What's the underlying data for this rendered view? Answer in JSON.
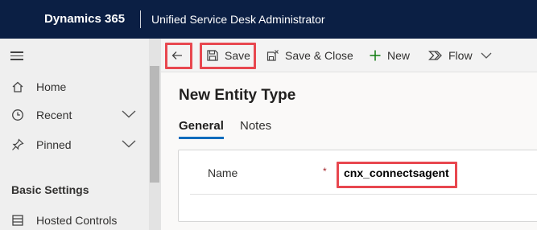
{
  "header": {
    "brand": "Dynamics 365",
    "app_name": "Unified Service Desk Administrator"
  },
  "sidebar": {
    "items": [
      {
        "label": "Home",
        "icon": "home-icon"
      },
      {
        "label": "Recent",
        "icon": "clock-icon"
      },
      {
        "label": "Pinned",
        "icon": "pin-icon"
      }
    ],
    "group_title": "Basic Settings",
    "group_items": [
      {
        "label": "Hosted Controls",
        "icon": "hosted-controls-icon"
      }
    ]
  },
  "toolbar": {
    "back_icon": "arrow-left-icon",
    "save_label": "Save",
    "save_close_label": "Save & Close",
    "new_label": "New",
    "flow_label": "Flow"
  },
  "form": {
    "title": "New Entity Type",
    "tabs": [
      {
        "label": "General",
        "active": true
      },
      {
        "label": "Notes",
        "active": false
      }
    ],
    "fields": [
      {
        "label": "Name",
        "required_marker": "*",
        "value": "cnx_connectsagent"
      }
    ]
  },
  "colors": {
    "topbar": "#0b1f44",
    "highlight": "#e8474f",
    "tab_accent": "#0f6cbd",
    "required": "#a4262c"
  }
}
